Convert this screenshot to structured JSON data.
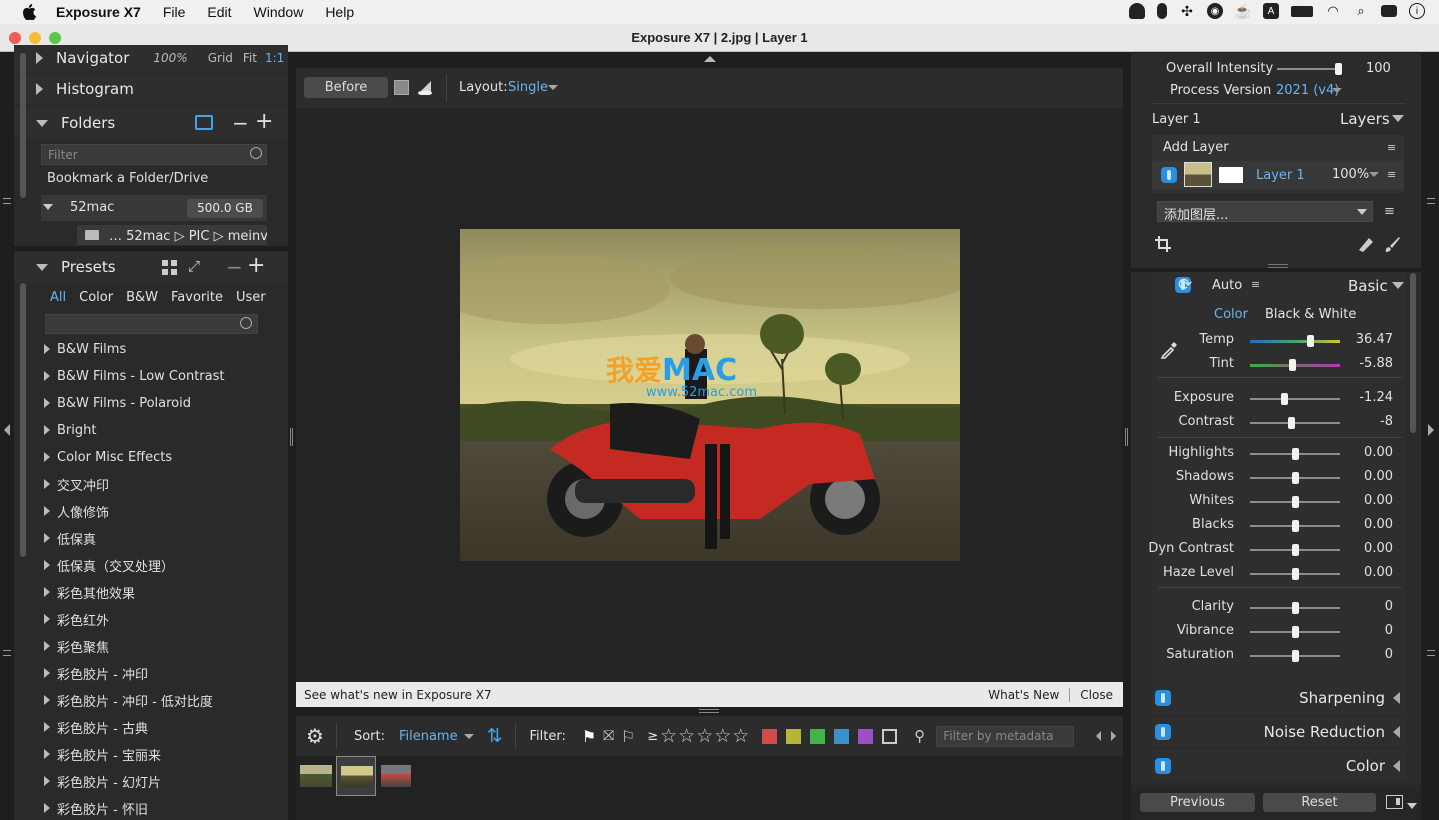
{
  "menubar": {
    "app": "Exposure X7",
    "items": [
      "File",
      "Edit",
      "Window",
      "Help"
    ]
  },
  "window": {
    "title": "Exposure X7 | 2.jpg | Layer 1"
  },
  "left": {
    "navigator": {
      "label": "Navigator",
      "zoom": "100%",
      "grid": "Grid",
      "fit": "Fit",
      "one": "1:1"
    },
    "histogram": {
      "label": "Histogram"
    },
    "folders": {
      "label": "Folders",
      "filter_placeholder": "Filter",
      "bookmark": "Bookmark a Folder/Drive",
      "drive": {
        "name": "52mac",
        "size": "500.0 GB"
      },
      "path": "… 52mac ▷ PIC ▷ meinv"
    },
    "presets": {
      "label": "Presets",
      "tabs": [
        "All",
        "Color",
        "B&W",
        "Favorite",
        "User"
      ],
      "items": [
        "B&W Films",
        "B&W Films - Low Contrast",
        "B&W Films - Polaroid",
        "Bright",
        "Color Misc Effects",
        "交叉冲印",
        "人像修饰",
        "低保真",
        "低保真（交叉处理）",
        "彩色其他效果",
        "彩色红外",
        "彩色聚焦",
        "彩色胶片 - 冲印",
        "彩色胶片 - 冲印 - 低对比度",
        "彩色胶片 - 古典",
        "彩色胶片 - 宝丽来",
        "彩色胶片 - 幻灯片",
        "彩色胶片 - 怀旧"
      ]
    }
  },
  "center": {
    "before_label": "Before",
    "layout_label": "Layout:",
    "layout_value": "Single",
    "watermark": {
      "cn": "我爱",
      "mac": "MAC",
      "url": "www.52mac.com"
    },
    "notice": {
      "text": "See what's new in Exposure X7",
      "whats_new": "What's New",
      "close": "Close"
    },
    "filmstrip": {
      "sort_label": "Sort:",
      "sort_value": "Filename",
      "filter_label": "Filter:",
      "gte": "≥",
      "stars": "☆☆☆☆☆",
      "metadata_placeholder": "Filter by metadata",
      "colors": [
        "#d24b4b",
        "#b7b43a",
        "#3fb54a",
        "#3a92c9",
        "#9c4fc6"
      ]
    }
  },
  "right": {
    "overall_intensity": {
      "label": "Overall Intensity",
      "value": "100",
      "level": 0.95
    },
    "process_version": {
      "label": "Process Version",
      "value": "2021 (v4)"
    },
    "layers": {
      "current": "Layer 1",
      "title": "Layers",
      "add_layer": "Add Layer",
      "layer_name": "Layer 1",
      "opacity": "100%",
      "add_cn": "添加图层..."
    },
    "basic": {
      "auto": "Auto",
      "title": "Basic",
      "mode_color": "Color",
      "mode_bw": "Black & White",
      "sliders": [
        {
          "label": "Temp",
          "value": "36.47",
          "level": 0.67
        },
        {
          "label": "Tint",
          "value": "-5.88",
          "level": 0.47
        },
        {
          "label": "Exposure",
          "value": "-1.24",
          "level": 0.38
        },
        {
          "label": "Contrast",
          "value": "-8",
          "level": 0.46
        },
        {
          "label": "Highlights",
          "value": "0.00",
          "level": 0.5
        },
        {
          "label": "Shadows",
          "value": "0.00",
          "level": 0.5
        },
        {
          "label": "Whites",
          "value": "0.00",
          "level": 0.5
        },
        {
          "label": "Blacks",
          "value": "0.00",
          "level": 0.5
        },
        {
          "label": "Dyn Contrast",
          "value": "0.00",
          "level": 0.5
        },
        {
          "label": "Haze Level",
          "value": "0.00",
          "level": 0.5
        },
        {
          "label": "Clarity",
          "value": "0",
          "level": 0.5
        },
        {
          "label": "Vibrance",
          "value": "0",
          "level": 0.5
        },
        {
          "label": "Saturation",
          "value": "0",
          "level": 0.5
        }
      ]
    },
    "sections": [
      "Sharpening",
      "Noise Reduction",
      "Color"
    ],
    "previous": "Previous",
    "reset": "Reset"
  }
}
